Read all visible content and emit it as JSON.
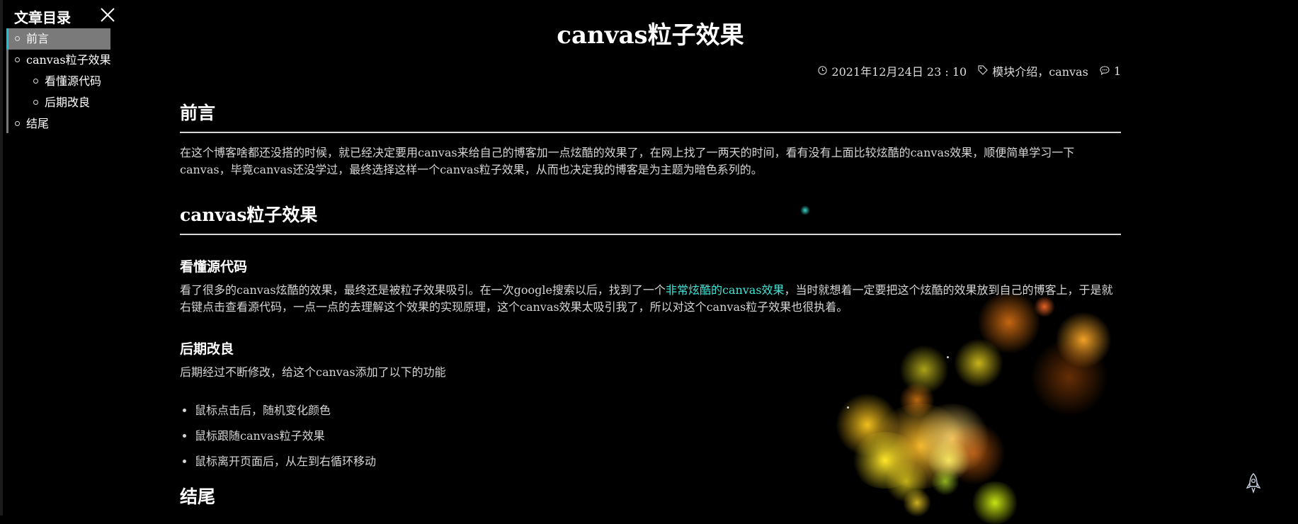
{
  "toc": {
    "title": "文章目录",
    "items": [
      {
        "label": "前言",
        "level": 1,
        "active": true
      },
      {
        "label": "canvas粒子效果",
        "level": 1,
        "active": false
      },
      {
        "label": "看懂源代码",
        "level": 2,
        "active": false
      },
      {
        "label": "后期改良",
        "level": 2,
        "active": false
      },
      {
        "label": "结尾",
        "level": 1,
        "active": false
      }
    ]
  },
  "post": {
    "title": "canvas粒子效果",
    "meta": {
      "date": "2021年12月24日 23 : 10",
      "tags": "模块介绍，canvas",
      "comments": "1"
    },
    "sections": {
      "preface": {
        "heading": "前言",
        "text": "在这个博客啥都还没搭的时候，就已经决定要用canvas来给自己的博客加一点炫酷的效果了，在网上找了一两天的时间，看有没有上面比较炫酷的canvas效果，顺便简单学习一下canvas，毕竟canvas还没学过，最终选择这样一个canvas粒子效果，从而也决定我的博客是为主题为暗色系列的。"
      },
      "particles": {
        "heading": "canvas粒子效果",
        "source": {
          "heading": "看懂源代码",
          "text_before": "看了很多的canvas炫酷的效果，最终还是被粒子效果吸引。在一次google搜索以后，找到了一个",
          "link": "非常炫酷的canvas效果",
          "text_after": "，当时就想着一定要把这个炫酷的效果放到自己的博客上，于是就右键点击查看源代码，一点一点的去理解这个效果的实现原理，这个canvas效果太吸引我了，所以对这个canvas粒子效果也很执着。"
        },
        "improve": {
          "heading": "后期改良",
          "text": "后期经过不断修改，给这个canvas添加了以下的功能",
          "features": [
            "鼠标点击后，随机变化颜色",
            "鼠标跟随canvas粒子效果",
            "鼠标离开页面后，从左到右循环移动"
          ]
        }
      },
      "ending": {
        "heading": "结尾"
      }
    }
  },
  "icons": {
    "close": "close-icon",
    "clock": "clock-icon",
    "tag": "tag-icon",
    "comment": "comment-icon",
    "rocket": "rocket-icon"
  },
  "colors": {
    "background": "#000000",
    "accent": "#19c3d8",
    "link": "#3ee6d8",
    "toc_active_bg": "#7a7a7a"
  }
}
